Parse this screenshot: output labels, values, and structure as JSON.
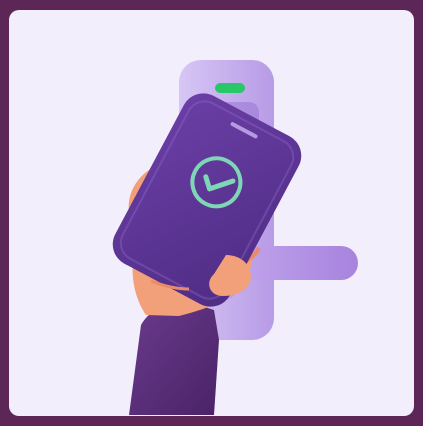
{
  "illustration": {
    "subject": "hand-holding-phone-unlocking-smart-lock",
    "icon": "check-circle-icon",
    "colors": {
      "frame": "#5c2756",
      "card": "#f3eefb",
      "lock_body": "#c9b3ef",
      "lock_shadow": "#a98ce0",
      "handle": "#b79be6",
      "indicator": "#27c76a",
      "phone": "#5e3796",
      "phone_screen_check": "#7fd6b6",
      "hand_skin": "#f2a07a",
      "sleeve": "#5b2f7c"
    }
  }
}
